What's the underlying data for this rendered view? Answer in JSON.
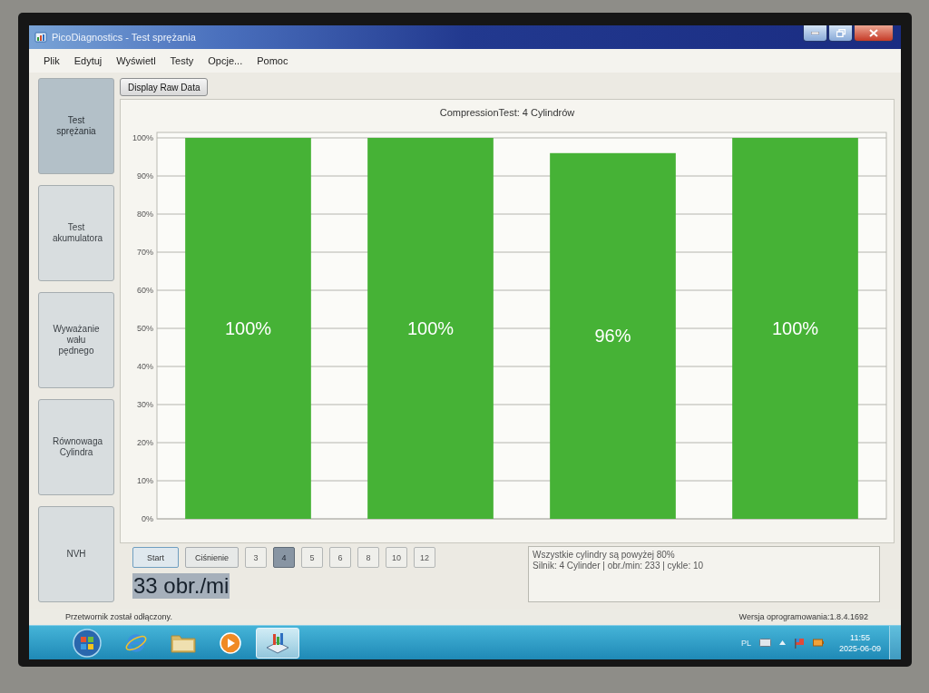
{
  "window": {
    "title": "PicoDiagnostics - Test sprężania"
  },
  "menu": [
    "Plik",
    "Edytuj",
    "Wyświetl",
    "Testy",
    "Opcje...",
    "Pomoc"
  ],
  "sidebar": {
    "items": [
      {
        "label": "Test sprężania",
        "selected": true
      },
      {
        "label": "Test akumulatora",
        "selected": false
      },
      {
        "label": "Wyważanie wału pędnego",
        "selected": false
      },
      {
        "label": "Równowaga Cylindra",
        "selected": false
      },
      {
        "label": "NVH",
        "selected": false
      }
    ]
  },
  "toolbar": {
    "button": "Display Raw Data"
  },
  "chart": {
    "chart_data": {
      "type": "bar",
      "title": "CompressionTest: 4 Cylindrów",
      "values": [
        100,
        100,
        96,
        100
      ],
      "ylim": [
        0,
        100
      ],
      "yticks": [
        {
          "value": 0,
          "label": "0%"
        },
        {
          "value": 10,
          "label": "10%"
        },
        {
          "value": 20,
          "label": "20%"
        },
        {
          "value": 30,
          "label": "30%"
        },
        {
          "value": 40,
          "label": "40%"
        },
        {
          "value": 50,
          "label": "50%"
        },
        {
          "value": 60,
          "label": "60%"
        },
        {
          "value": 70,
          "label": "70%"
        },
        {
          "value": 80,
          "label": "80%"
        },
        {
          "value": 90,
          "label": "90%"
        },
        {
          "value": 100,
          "label": "100%"
        }
      ],
      "grid": true,
      "value_labels": [
        "100%",
        "100%",
        "96%",
        "100%"
      ]
    }
  },
  "controls": {
    "buttons": [
      "Start",
      "Ciśnienie"
    ],
    "cylinders": [
      {
        "label": "3",
        "selected": false
      },
      {
        "label": "4",
        "selected": true
      },
      {
        "label": "5",
        "selected": false
      },
      {
        "label": "6",
        "selected": false
      },
      {
        "label": "8",
        "selected": false
      },
      {
        "label": "10",
        "selected": false
      },
      {
        "label": "12",
        "selected": false
      }
    ]
  },
  "rpm_readout": "33 obr./mi",
  "messages": [
    "Wszystkie cylindry są powyżej 80%",
    "Silnik: 4 Cylinder | obr./min: 233 | cykle: 10"
  ],
  "status_bar": {
    "left": "Przetwornik został odłączony.",
    "right": "Wersja oprogramowania:1.8.4.1692"
  },
  "taskbar": {
    "apps": [
      {
        "kind": "browser",
        "selected": false
      },
      {
        "kind": "folder",
        "selected": false
      },
      {
        "kind": "media",
        "selected": false
      },
      {
        "kind": "diagnostics",
        "selected": true
      }
    ],
    "language": "PL",
    "clock": {
      "time": "11:55",
      "date": "2025-06-09"
    }
  }
}
